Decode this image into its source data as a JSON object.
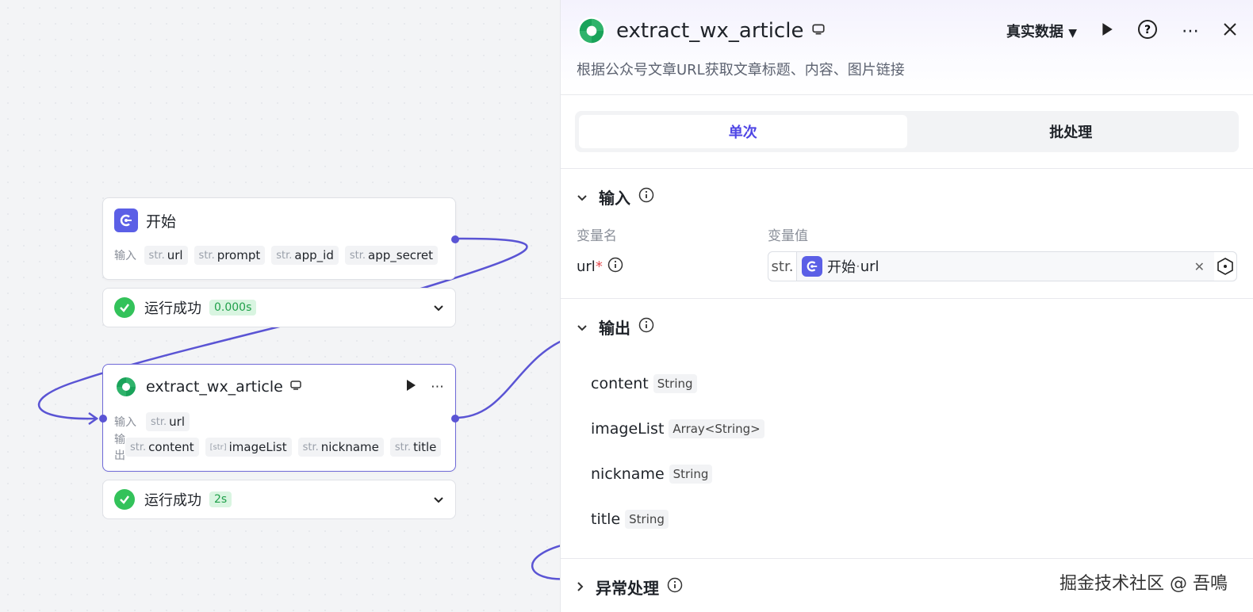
{
  "canvas": {
    "start_node": {
      "title": "开始",
      "input_label": "输入",
      "inputs": [
        {
          "type": "str.",
          "name": "url"
        },
        {
          "type": "str.",
          "name": "prompt"
        },
        {
          "type": "str.",
          "name": "app_id"
        },
        {
          "type": "str.",
          "name": "app_secret"
        }
      ],
      "status": {
        "text": "运行成功",
        "time": "0.000s"
      }
    },
    "plugin_node": {
      "title": "extract_wx_article",
      "input_label": "输入",
      "output_label": "输出",
      "inputs": [
        {
          "type": "str.",
          "name": "url"
        }
      ],
      "outputs": [
        {
          "type": "str.",
          "name": "content"
        },
        {
          "type": "[str]",
          "name": "imageList"
        },
        {
          "type": "str.",
          "name": "nickname"
        },
        {
          "type": "str.",
          "name": "title"
        }
      ],
      "status": {
        "text": "运行成功",
        "time": "2s"
      }
    }
  },
  "panel": {
    "title": "extract_wx_article",
    "data_mode": "真实数据",
    "description": "根据公众号文章URL获取文章标题、内容、图片链接",
    "tabs": {
      "single": "单次",
      "batch": "批处理"
    },
    "input_section": {
      "title": "输入",
      "col_name": "变量名",
      "col_value": "变量值",
      "row": {
        "name": "url",
        "required_mark": "*",
        "type": "str.",
        "ref_node": "开始",
        "ref_sep": " · ",
        "ref_var": "url"
      }
    },
    "output_section": {
      "title": "输出",
      "items": [
        {
          "name": "content",
          "type": "String"
        },
        {
          "name": "imageList",
          "type": "Array<String>"
        },
        {
          "name": "nickname",
          "type": "String"
        },
        {
          "name": "title",
          "type": "String"
        }
      ]
    },
    "error_section": {
      "title": "异常处理"
    }
  },
  "watermark": "掘金技术社区 @ 吾鳴",
  "colors": {
    "accent": "#5a54d4",
    "success": "#33c25a",
    "brand_green": "#2fb36b"
  }
}
